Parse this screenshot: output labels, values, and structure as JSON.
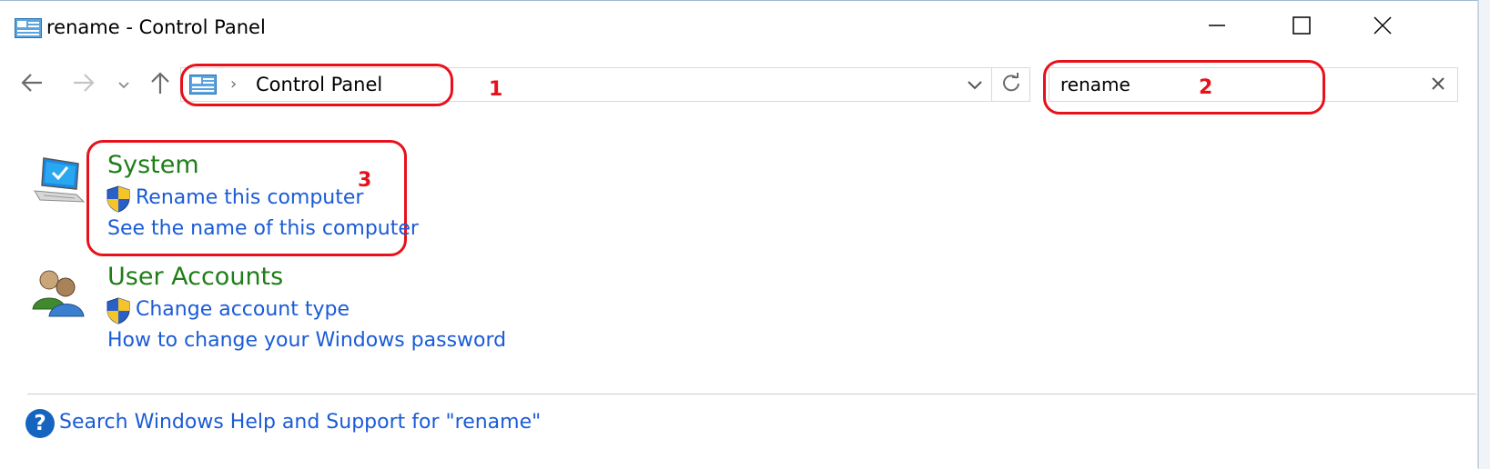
{
  "window": {
    "title": "rename - Control Panel",
    "minimize_icon": "minimize-icon",
    "maximize_icon": "maximize-icon",
    "close_icon": "close-icon"
  },
  "nav": {
    "back_icon": "back-arrow-icon",
    "forward_icon": "forward-arrow-icon",
    "recent_icon": "chevron-down-icon",
    "up_icon": "up-arrow-icon"
  },
  "address": {
    "separator": "›",
    "location": "Control Panel",
    "dropdown_icon": "chevron-down-icon",
    "refresh_icon": "refresh-icon"
  },
  "search": {
    "value": "rename",
    "clear_icon": "close-icon"
  },
  "annotations": [
    "1",
    "2",
    "3"
  ],
  "results": [
    {
      "title": "System",
      "icon": "computer-icon",
      "links": [
        {
          "label": "Rename this computer",
          "shield": true
        },
        {
          "label": "See the name of this computer",
          "shield": false
        }
      ]
    },
    {
      "title": "User Accounts",
      "icon": "users-icon",
      "links": [
        {
          "label": "Change account type",
          "shield": true
        },
        {
          "label": "How to change your Windows password",
          "shield": false
        }
      ]
    }
  ],
  "help": {
    "icon_glyph": "?",
    "label": "Search Windows Help and Support for \"rename\""
  },
  "colors": {
    "link": "#1a5bd6",
    "category": "#1e7e17",
    "annotation": "#e8111b"
  }
}
